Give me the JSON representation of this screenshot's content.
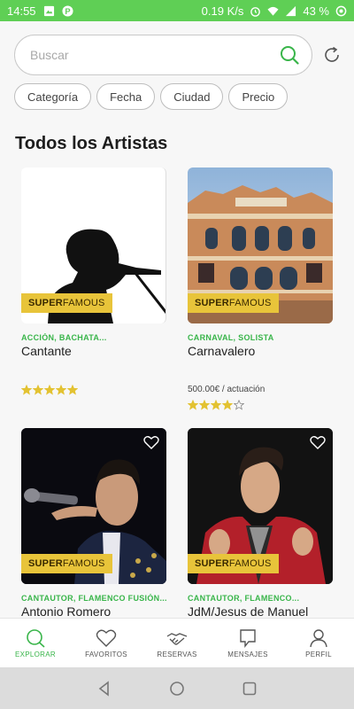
{
  "status_bar": {
    "time": "14:55",
    "speed": "0.19 K/s",
    "battery": "43 %"
  },
  "search": {
    "placeholder": "Buscar"
  },
  "filters": [
    "Categoría",
    "Fecha",
    "Ciudad",
    "Precio"
  ],
  "section_title": "Todos los Artistas",
  "badge": {
    "strong": "SUPER",
    "rest": "FAMOUS"
  },
  "cards": [
    {
      "tags": "ACCIÓN,  BACHATA...",
      "name": "Cantante",
      "price": "",
      "rating": 5
    },
    {
      "tags": "CARNAVAL,  SOLISTA",
      "name": "Carnavalero",
      "price": "500.00€ / actuación",
      "rating": 4
    },
    {
      "tags": "CANTAUTOR,  FLAMENCO FUSIÓN...",
      "name": "Antonio Romero",
      "price": "",
      "rating": 0
    },
    {
      "tags": "CANTAUTOR,  FLAMENCO...",
      "name": "JdM/Jesus de Manuel",
      "price": "",
      "rating": 0
    }
  ],
  "nav": {
    "explore": "EXPLORAR",
    "favorites": "FAVORITOS",
    "bookings": "RESERVAS",
    "messages": "MENSAJES",
    "profile": "PERFIL"
  },
  "colors": {
    "accent": "#39b54a",
    "status_bar": "#5fcf55",
    "badge": "#e8c43a"
  }
}
